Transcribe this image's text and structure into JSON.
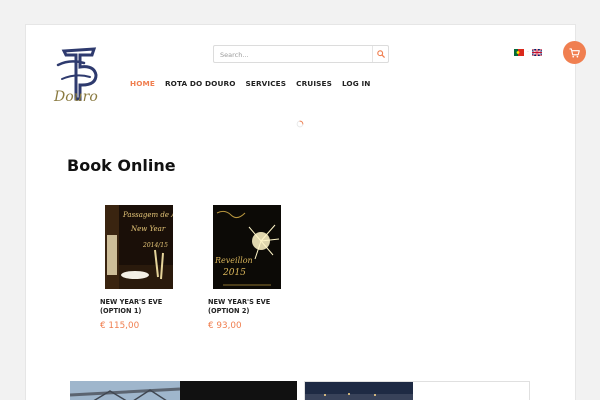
{
  "logo": {
    "alt": "Douro logo",
    "text": "Douro"
  },
  "search": {
    "placeholder": "Search..."
  },
  "languages": [
    "pt",
    "en"
  ],
  "nav": {
    "items": [
      {
        "label": "HOME",
        "active": true
      },
      {
        "label": "ROTA DO DOURO",
        "active": false
      },
      {
        "label": "SERVICES",
        "active": false
      },
      {
        "label": "CRUISES",
        "active": false
      },
      {
        "label": "LOG IN",
        "active": false
      }
    ]
  },
  "page": {
    "title_bold": "Book",
    "title_rest": " Online"
  },
  "products": [
    {
      "name": "NEW YEAR'S EVE\n(OPTION 1)",
      "price": "€ 115,00",
      "thumb_text": [
        "Passagem de Ano",
        "New Year",
        "2014/15"
      ]
    },
    {
      "name": "NEW YEAR'S EVE\n(OPTION 2)",
      "price": "€ 93,00",
      "thumb_text": [
        "Reveillon",
        "2015"
      ]
    }
  ],
  "colors": {
    "accent": "#f07f50",
    "text": "#222222",
    "background": "#f2f2f2"
  },
  "icons": [
    "search-icon",
    "cart-icon",
    "loader-icon",
    "flag-pt-icon",
    "flag-en-icon"
  ]
}
